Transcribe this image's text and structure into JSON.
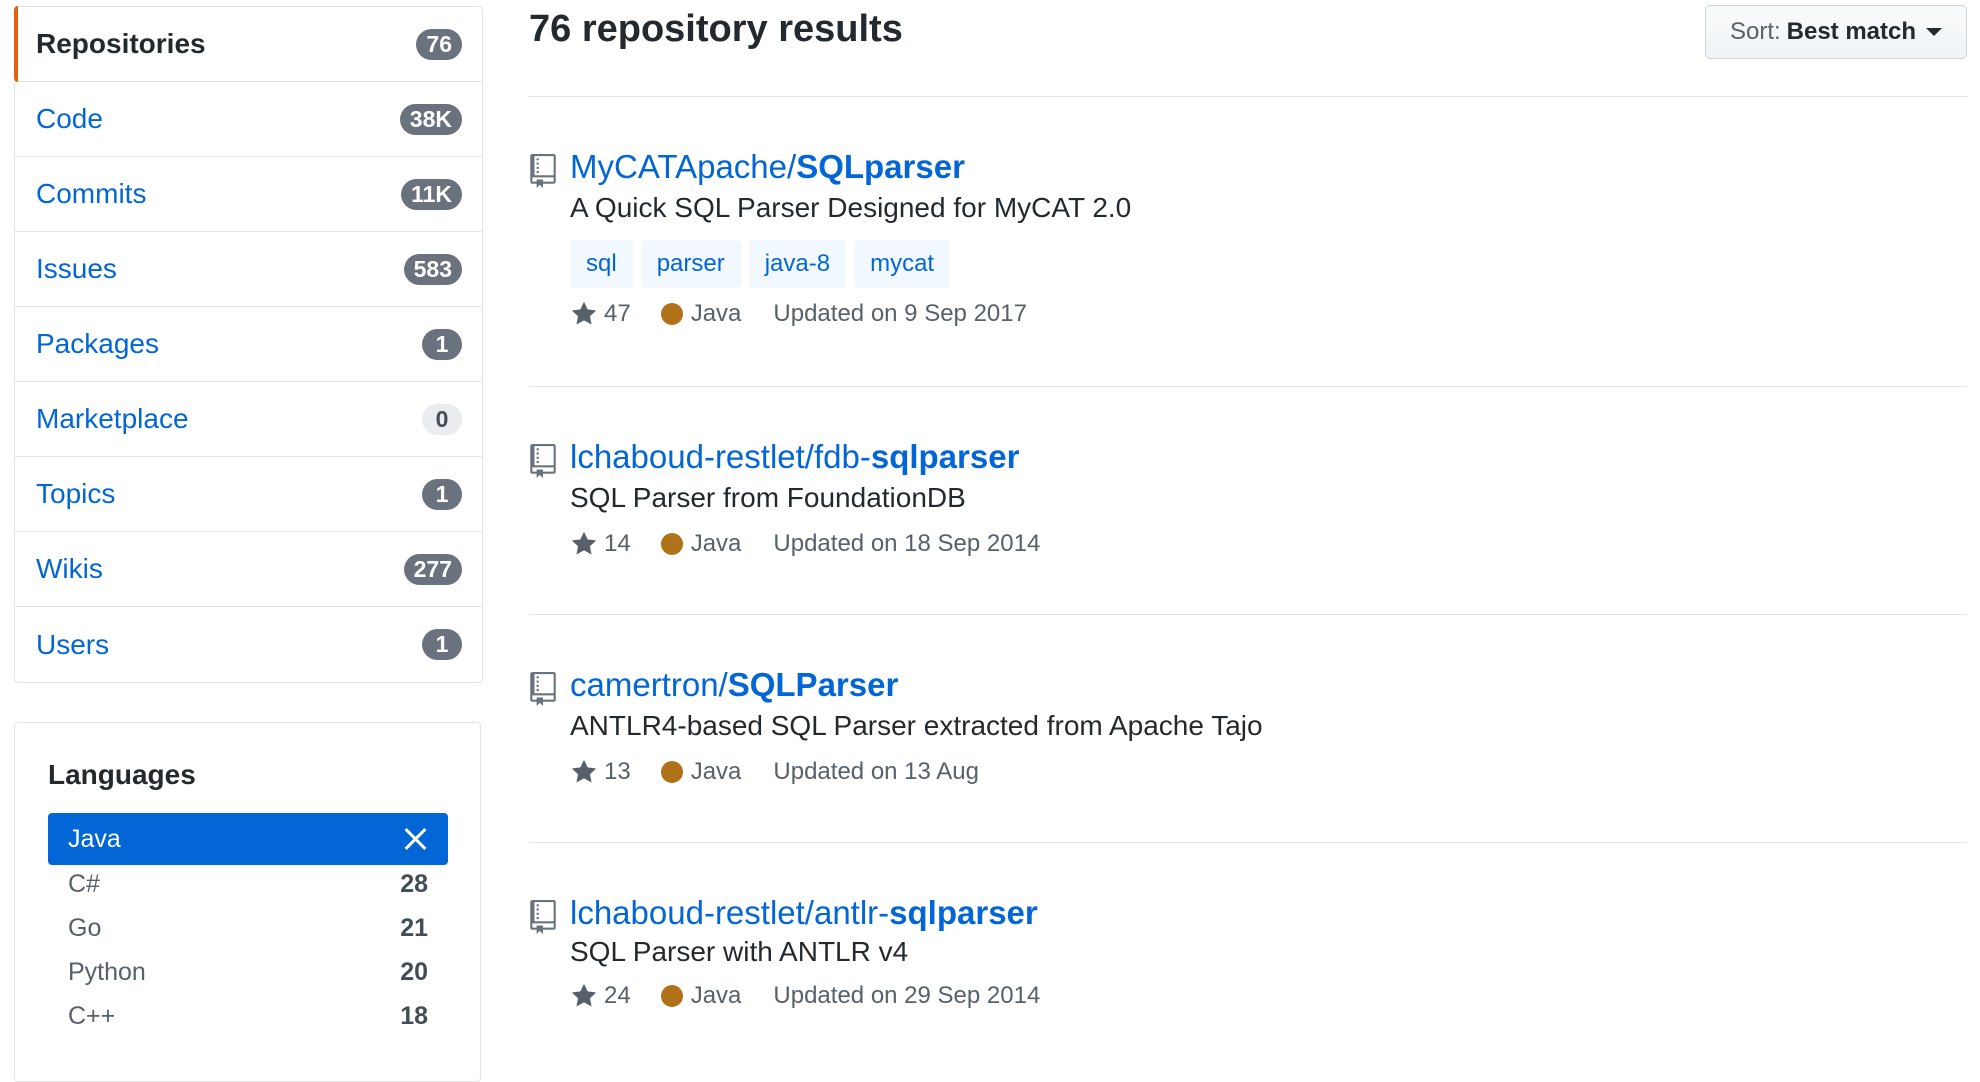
{
  "filters": [
    {
      "label": "Repositories",
      "count": "76",
      "selected": true
    },
    {
      "label": "Code",
      "count": "38K"
    },
    {
      "label": "Commits",
      "count": "11K"
    },
    {
      "label": "Issues",
      "count": "583"
    },
    {
      "label": "Packages",
      "count": "1"
    },
    {
      "label": "Marketplace",
      "count": "0"
    },
    {
      "label": "Topics",
      "count": "1"
    },
    {
      "label": "Wikis",
      "count": "277"
    },
    {
      "label": "Users",
      "count": "1"
    }
  ],
  "languages": {
    "title": "Languages",
    "items": [
      {
        "name": "Java",
        "count": "",
        "active": true
      },
      {
        "name": "C#",
        "count": "28"
      },
      {
        "name": "Go",
        "count": "21"
      },
      {
        "name": "Python",
        "count": "20"
      },
      {
        "name": "C++",
        "count": "18"
      }
    ]
  },
  "results": {
    "title": "76 repository results",
    "sort_prefix": "Sort:",
    "sort_value": "Best match"
  },
  "repos": [
    {
      "owner": "MyCATApache/",
      "name": "SQLparser",
      "description": "A Quick SQL Parser Designed for MyCAT 2.0",
      "topics": [
        "sql",
        "parser",
        "java-8",
        "mycat"
      ],
      "stars": "47",
      "language": "Java",
      "updated": "Updated on 9 Sep 2017"
    },
    {
      "owner": "lchaboud-restlet/fdb-",
      "name": "sqlparser",
      "description": "SQL Parser from FoundationDB",
      "topics": [],
      "stars": "14",
      "language": "Java",
      "updated": "Updated on 18 Sep 2014"
    },
    {
      "owner": "camertron/",
      "name": "SQLParser",
      "description": "ANTLR4-based SQL Parser extracted from Apache Tajo",
      "topics": [],
      "stars": "13",
      "language": "Java",
      "updated": "Updated on 13 Aug"
    },
    {
      "owner": "lchaboud-restlet/antlr-",
      "name": "sqlparser",
      "description": "SQL Parser with ANTLR v4",
      "topics": [],
      "stars": "24",
      "language": "Java",
      "updated": "Updated on 29 Sep 2014"
    }
  ],
  "colors": {
    "accent": "#0366d6",
    "java": "#b07219",
    "selected_bar": "#e36209"
  }
}
